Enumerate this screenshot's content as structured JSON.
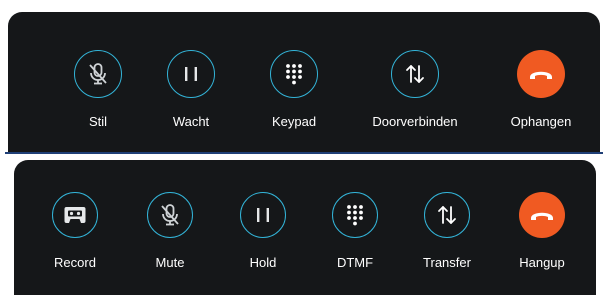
{
  "colors": {
    "bar_background": "#151719",
    "ring": "#33b4d8",
    "hangup": "#f05a22",
    "label": "#ffffff",
    "divider": "#1f3f77"
  },
  "dutch_bar": {
    "buttons": [
      {
        "label": "Stil",
        "icon": "mic-off-icon"
      },
      {
        "label": "Wacht",
        "icon": "pause-icon"
      },
      {
        "label": "Keypad",
        "icon": "keypad-icon"
      },
      {
        "label": "Doorverbinden",
        "icon": "transfer-arrows-icon"
      },
      {
        "label": "Ophangen",
        "icon": "hangup-phone-icon"
      }
    ]
  },
  "english_bar": {
    "buttons": [
      {
        "label": "Record",
        "icon": "cassette-icon"
      },
      {
        "label": "Mute",
        "icon": "mic-off-icon"
      },
      {
        "label": "Hold",
        "icon": "pause-icon"
      },
      {
        "label": "DTMF",
        "icon": "keypad-icon"
      },
      {
        "label": "Transfer",
        "icon": "transfer-arrows-icon"
      },
      {
        "label": "Hangup",
        "icon": "hangup-phone-icon"
      }
    ]
  }
}
